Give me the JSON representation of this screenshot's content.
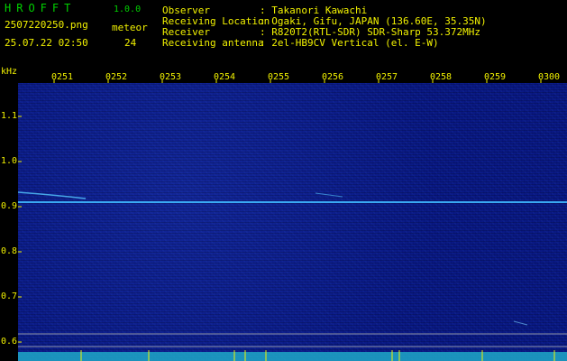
{
  "app": {
    "name": "HROFFT",
    "version": "1.0.0"
  },
  "file": {
    "name": "2507220250.png",
    "timestamp": "25.07.22 02:50"
  },
  "meteor": {
    "label": "meteor",
    "count": "24"
  },
  "info": [
    {
      "key": "Observer",
      "value": ": Takanori Kawachi"
    },
    {
      "key": "Receiving Location",
      "value": ": Ogaki, Gifu, JAPAN (136.60E, 35.35N)"
    },
    {
      "key": "Receiver",
      "value": ": R820T2(RTL-SDR) SDR-Sharp 53.372MHz"
    },
    {
      "key": "Receiving antenna",
      "value": ": 2el-HB9CV Vertical (el. E-W)"
    }
  ],
  "axis": {
    "unit": "kHz",
    "y_ticks": [
      "1.1",
      "1.0",
      "0.9",
      "0.8",
      "0.7",
      "0.6"
    ],
    "x_ticks": [
      "0251",
      "0252",
      "0253",
      "0254",
      "0255",
      "0256",
      "0257",
      "0258",
      "0259",
      "0300"
    ]
  }
}
